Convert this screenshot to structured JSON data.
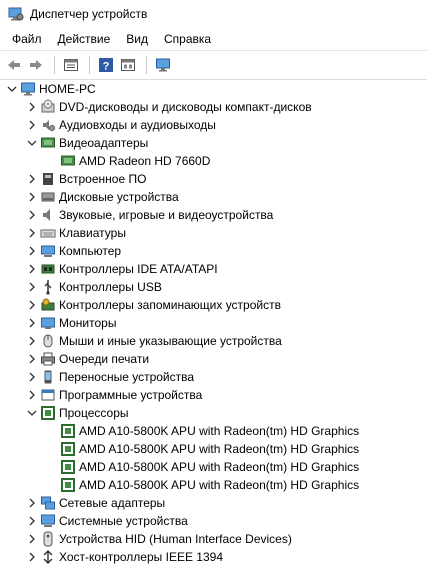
{
  "window": {
    "title": "Диспетчер устройств"
  },
  "menu": [
    "Файл",
    "Действие",
    "Вид",
    "Справка"
  ],
  "toolbar": {
    "buttons": [
      "back-icon",
      "forward-icon",
      "properties-icon",
      "help-icon",
      "view-icon",
      "monitor-scan-icon"
    ]
  },
  "tree": {
    "root": "HOME-PC",
    "nodes": [
      {
        "label": "DVD-дисководы и дисководы компакт-дисков",
        "icon": "dvd-drive-icon",
        "expanded": false
      },
      {
        "label": "Аудиовходы и аудиовыходы",
        "icon": "audio-io-icon",
        "expanded": false
      },
      {
        "label": "Видеоадаптеры",
        "icon": "display-adapter-icon",
        "expanded": true,
        "children": [
          "AMD Radeon HD 7660D"
        ]
      },
      {
        "label": "Встроенное ПО",
        "icon": "firmware-icon",
        "expanded": false
      },
      {
        "label": "Дисковые устройства",
        "icon": "disk-drive-icon",
        "expanded": false
      },
      {
        "label": "Звуковые, игровые и видеоустройства",
        "icon": "sound-icon",
        "expanded": false
      },
      {
        "label": "Клавиатуры",
        "icon": "keyboard-icon",
        "expanded": false
      },
      {
        "label": "Компьютер",
        "icon": "computer-icon",
        "expanded": false
      },
      {
        "label": "Контроллеры IDE ATA/ATAPI",
        "icon": "ide-controller-icon",
        "expanded": false
      },
      {
        "label": "Контроллеры USB",
        "icon": "usb-icon",
        "expanded": false
      },
      {
        "label": "Контроллеры запоминающих устройств",
        "icon": "storage-controller-icon",
        "expanded": false
      },
      {
        "label": "Мониторы",
        "icon": "monitor-icon",
        "expanded": false
      },
      {
        "label": "Мыши и иные указывающие устройства",
        "icon": "mouse-icon",
        "expanded": false
      },
      {
        "label": "Очереди печати",
        "icon": "printer-icon",
        "expanded": false
      },
      {
        "label": "Переносные устройства",
        "icon": "portable-device-icon",
        "expanded": false
      },
      {
        "label": "Программные устройства",
        "icon": "software-device-icon",
        "expanded": false
      },
      {
        "label": "Процессоры",
        "icon": "processor-icon",
        "expanded": true,
        "children": [
          "AMD A10-5800K APU with Radeon(tm) HD Graphics",
          "AMD A10-5800K APU with Radeon(tm) HD Graphics",
          "AMD A10-5800K APU with Radeon(tm) HD Graphics",
          "AMD A10-5800K APU with Radeon(tm) HD Graphics"
        ]
      },
      {
        "label": "Сетевые адаптеры",
        "icon": "network-adapter-icon",
        "expanded": false
      },
      {
        "label": "Системные устройства",
        "icon": "system-device-icon",
        "expanded": false
      },
      {
        "label": "Устройства HID (Human Interface Devices)",
        "icon": "hid-icon",
        "expanded": false
      },
      {
        "label": "Хост-контроллеры IEEE 1394",
        "icon": "ieee1394-icon",
        "expanded": false
      }
    ]
  }
}
